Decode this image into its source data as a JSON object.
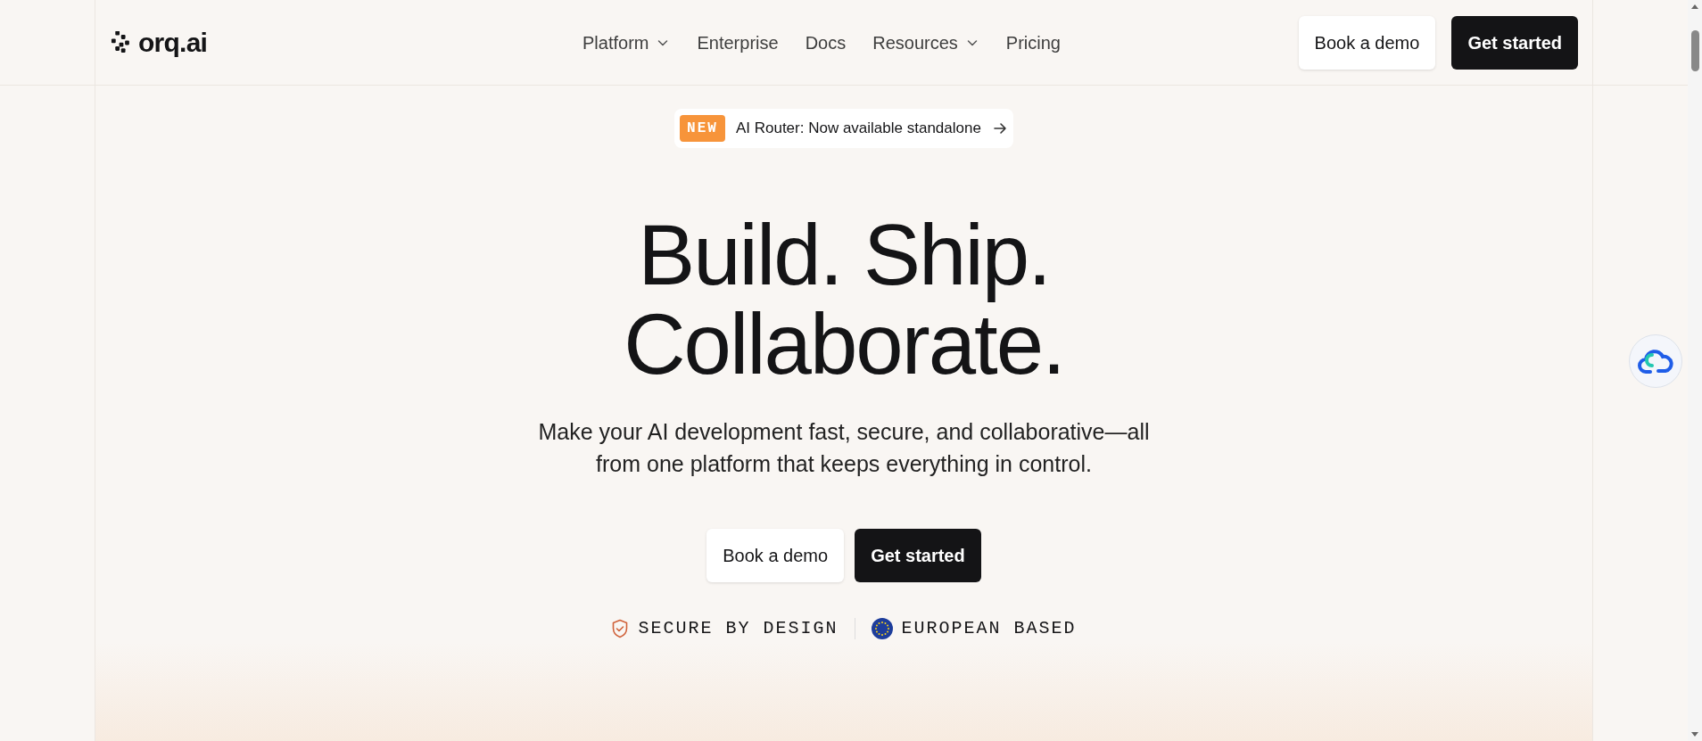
{
  "header": {
    "logo": "orq.ai",
    "nav": [
      {
        "label": "Platform",
        "dropdown": true
      },
      {
        "label": "Enterprise",
        "dropdown": false
      },
      {
        "label": "Docs",
        "dropdown": false
      },
      {
        "label": "Resources",
        "dropdown": true
      },
      {
        "label": "Pricing",
        "dropdown": false
      }
    ],
    "buttons": [
      {
        "label": "Book a demo",
        "kind": "secondary"
      },
      {
        "label": "Get started",
        "kind": "primary"
      }
    ]
  },
  "announcement": {
    "badge": "NEW",
    "text": "AI Router: Now available standalone"
  },
  "hero": {
    "title_lines": [
      "Build. Ship.",
      "Collaborate."
    ],
    "subtitle_lines": [
      "Make your AI development fast, secure, and collaborative—all",
      "from one platform that keeps everything in control."
    ],
    "buttons": [
      {
        "label": "Book a demo",
        "kind": "secondary"
      },
      {
        "label": "Get started",
        "kind": "primary"
      }
    ],
    "trust": [
      {
        "label": "SECURE BY DESIGN",
        "kind": "shield"
      },
      {
        "label": "EUROPEAN BASED",
        "kind": "eu"
      }
    ]
  }
}
